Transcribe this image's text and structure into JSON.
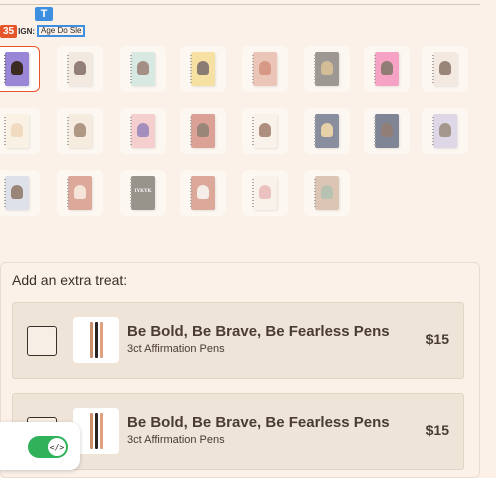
{
  "inspector": {
    "badge": "35",
    "design_label": "IGN:",
    "design_value": "Age Do Sle",
    "text_marker": "T"
  },
  "thumbnails": [
    {
      "color": "#9a86d6",
      "fig": "#3b2a22",
      "selected": true,
      "text": ""
    },
    {
      "color": "#ece3d6",
      "fig": "#4a3028",
      "selected": false,
      "text": ""
    },
    {
      "color": "#bfe0d8",
      "fig": "#6b4a3a",
      "selected": false,
      "text": ""
    },
    {
      "color": "#f3d46e",
      "fig": "#3f2a20",
      "selected": false,
      "text": ""
    },
    {
      "color": "#e0a490",
      "fig": "#c05a40",
      "selected": false,
      "text": ""
    },
    {
      "color": "#5e5a55",
      "fig": "#b7985a",
      "selected": false,
      "text": ""
    },
    {
      "color": "#f06aa8",
      "fig": "#4a2d20",
      "selected": false,
      "text": ""
    },
    {
      "color": "#efe0d6",
      "fig": "#5a3a2a",
      "selected": false,
      "text": ""
    },
    {
      "color": "#f7f0dc",
      "fig": "#e8c8a0",
      "selected": false,
      "text": ""
    },
    {
      "color": "#f2e4d4",
      "fig": "#7a5a3a",
      "selected": false,
      "text": ""
    },
    {
      "color": "#efb6b6",
      "fig": "#6a4a9a",
      "selected": false,
      "text": ""
    },
    {
      "color": "#c7695a",
      "fig": "#5a3a2a",
      "selected": false,
      "text": ""
    },
    {
      "color": "#f7efe5",
      "fig": "#7a4a30",
      "selected": false,
      "text": ""
    },
    {
      "color": "#3c4a66",
      "fig": "#d8b878",
      "selected": false,
      "text": ""
    },
    {
      "color": "#2c3a58",
      "fig": "#4a2f24",
      "selected": false,
      "text": ""
    },
    {
      "color": "#c9c3e2",
      "fig": "#6a5a4a",
      "selected": false,
      "text": ""
    },
    {
      "color": "#cbd3e6",
      "fig": "#5a3a2a",
      "selected": false,
      "text": ""
    },
    {
      "color": "#c77460",
      "fig": "#f0d8c8",
      "selected": false,
      "text": ""
    },
    {
      "color": "#55534a",
      "fig": "#55534a",
      "selected": false,
      "text": "IYKYK"
    },
    {
      "color": "#c77460",
      "fig": "#f0e8e0",
      "selected": false,
      "text": ""
    },
    {
      "color": "#f7efe8",
      "fig": "#e0a0a0",
      "selected": false,
      "text": ""
    },
    {
      "color": "#c7a58a",
      "fig": "#8aa08a",
      "selected": false,
      "text": ""
    }
  ],
  "treat": {
    "title": "Add an extra treat:",
    "items": [
      {
        "name": "Be Bold, Be Brave, Be Fearless Pens",
        "sub": "3ct Affirmation Pens",
        "price": "$15"
      },
      {
        "name": "Be Bold, Be Brave, Be Fearless Pens",
        "sub": "3ct Affirmation Pens",
        "price": "$15"
      }
    ]
  },
  "widget": {
    "toggle_icon": "</>"
  }
}
